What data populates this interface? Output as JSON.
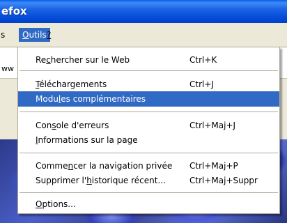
{
  "window": {
    "title_partial": "efox"
  },
  "menubar": {
    "partial_item": "s",
    "outils": {
      "before": "",
      "mnemonic": "O",
      "after": "utils"
    },
    "help": {
      "before": "",
      "mnemonic": "?",
      "after": ""
    }
  },
  "background": {
    "url_fragment": "ww"
  },
  "menu": {
    "items": [
      {
        "before": "Re",
        "mnemonic": "c",
        "after": "hercher sur le Web",
        "shortcut": "Ctrl+K",
        "highlighted": false
      },
      {
        "before": "",
        "mnemonic": "T",
        "after": "éléchargements",
        "shortcut": "Ctrl+J",
        "highlighted": false
      },
      {
        "before": "Modu",
        "mnemonic": "l",
        "after": "es complémentaires",
        "shortcut": "",
        "highlighted": true
      },
      {
        "before": "Con",
        "mnemonic": "s",
        "after": "ole d'erreurs",
        "shortcut": "Ctrl+Maj+J",
        "highlighted": false
      },
      {
        "before": "",
        "mnemonic": "I",
        "after": "nformations sur la page",
        "shortcut": "",
        "highlighted": false
      },
      {
        "before": "Comme",
        "mnemonic": "n",
        "after": "cer la navigation privée",
        "shortcut": "Ctrl+Maj+P",
        "highlighted": false
      },
      {
        "before": "Supprimer l'",
        "mnemonic": "h",
        "after": "istorique récent...",
        "shortcut": "Ctrl+Maj+Suppr",
        "highlighted": false
      },
      {
        "before": "",
        "mnemonic": "O",
        "after": "ptions...",
        "shortcut": "",
        "highlighted": false
      }
    ]
  },
  "colors": {
    "highlight": "#316ac5",
    "titlebar": "#0a5ce8",
    "menubar": "#ece9d8"
  }
}
